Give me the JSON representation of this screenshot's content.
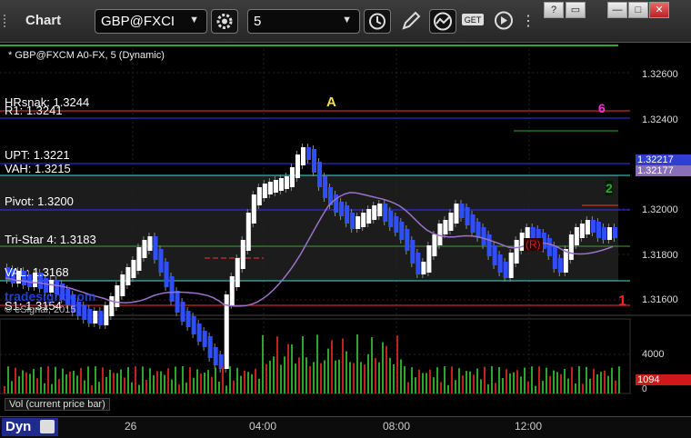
{
  "window": {
    "app_title": "Chart",
    "symbol": "GBP@FXCI",
    "interval": "5",
    "window_buttons": [
      "?",
      "▭",
      "—",
      "□",
      "✕"
    ]
  },
  "chart": {
    "header": "* GBP@FXCM A0-FX, 5 (Dynamic)",
    "price_labels": [
      "1.32600",
      "1.32400",
      "1.32217",
      "1.32177",
      "1.32000",
      "1.31800",
      "1.31600"
    ],
    "current_price": "1.32217",
    "prev_price": "1.32177",
    "levels": [
      {
        "label": "HRsnak: 1.3244",
        "color": "#ffffff"
      },
      {
        "label": "R1: 1.3241",
        "color": "#ff3030"
      },
      {
        "label": "UPT: 1.3221",
        "color": "#3030ff"
      },
      {
        "label": "VAH: 1.3215",
        "color": "#40e0d0"
      },
      {
        "label": "Pivot: 1.3200",
        "color": "#ffffff"
      },
      {
        "label": "Tri-Star 4: 1.3183",
        "color": "#2fa82f"
      },
      {
        "label": "VAL: 1.3168",
        "color": "#40e0d0"
      },
      {
        "label": "S1: 1.3154",
        "color": "#ff3030"
      }
    ],
    "markers": {
      "a_label": "A",
      "r_label": "(R)",
      "count_top": "6",
      "count_right": "1",
      "count_mid": "2"
    },
    "watermark": "© eSignal, 2015",
    "watermark2": "tradesight.com"
  },
  "volume": {
    "label": "Vol (current price bar)",
    "axis_label": "4000",
    "axis_zero": "0",
    "current": "1094"
  },
  "bottom": {
    "mode": "Dyn",
    "ticks": [
      "26",
      "04:00",
      "08:00",
      "12:00"
    ]
  },
  "colors": {
    "up_bar": "#ffffff",
    "down_bar": "#2f4fff",
    "vol_up": "#2ea62e",
    "vol_down": "#c32020",
    "vwap": "#9b72c8"
  }
}
